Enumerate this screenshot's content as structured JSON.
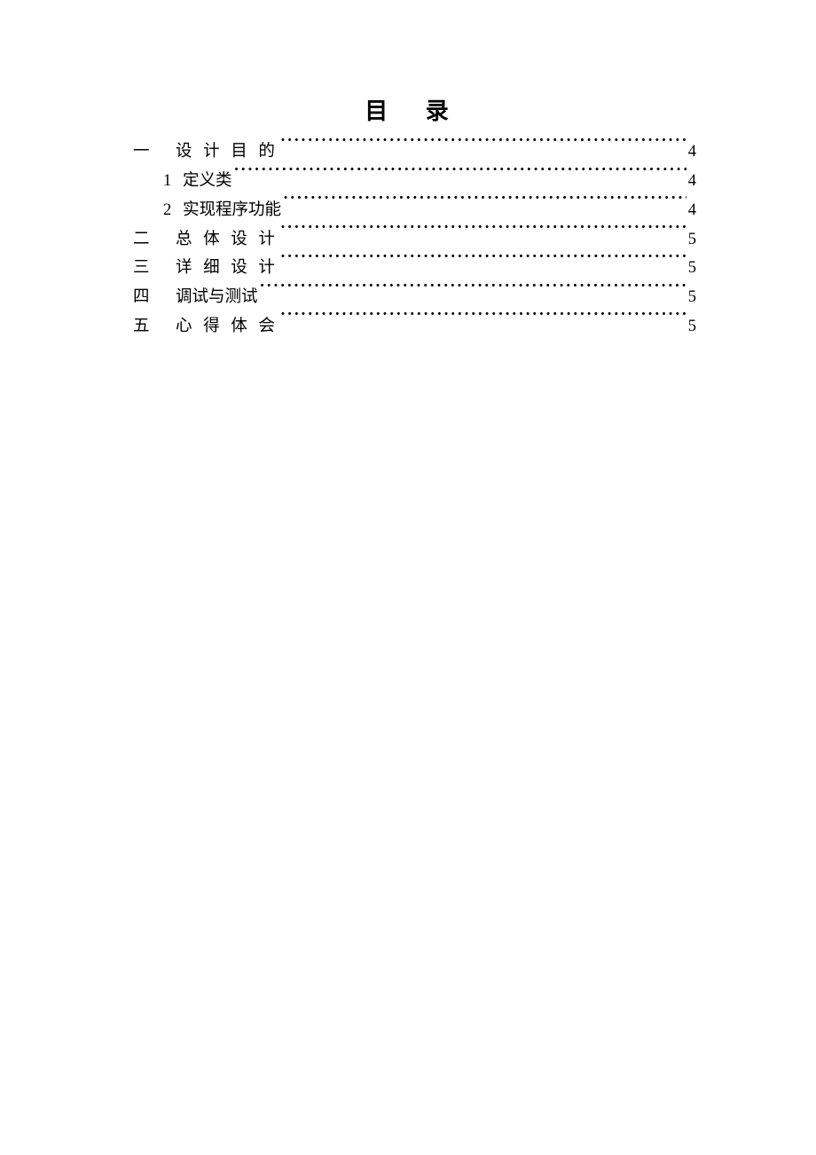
{
  "title": "目  录",
  "toc": [
    {
      "level": 1,
      "num": "一",
      "label": "设 计 目 的",
      "page": "4"
    },
    {
      "level": 2,
      "num": "1",
      "label": "定义类",
      "page": "4"
    },
    {
      "level": 2,
      "num": "2",
      "label": "实现程序功能",
      "page": "4"
    },
    {
      "level": 1,
      "num": "二",
      "label": "总 体 设 计",
      "page": "5"
    },
    {
      "level": 1,
      "num": "三",
      "label": "详 细 设 计",
      "page": "5"
    },
    {
      "level": 1,
      "num": "四",
      "label": "调试与测试",
      "page": "5"
    },
    {
      "level": 1,
      "num": "五",
      "label": "心 得 体 会",
      "page": "5"
    }
  ]
}
